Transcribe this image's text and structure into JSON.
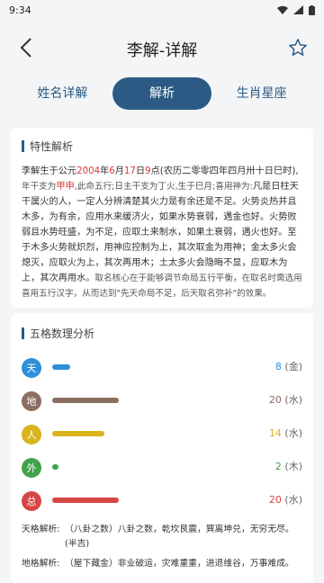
{
  "status_bar": {
    "time": "9:34"
  },
  "header": {
    "title": "李解-详解"
  },
  "tabs": [
    {
      "label": "姓名详解",
      "active": false
    },
    {
      "label": "解析",
      "active": true
    },
    {
      "label": "生肖星座",
      "active": false
    }
  ],
  "characteristic": {
    "section_title": "特性解析",
    "p1_a": "李解生于公元",
    "p1_year": "2004",
    "p1_b": "年",
    "p1_month": "6",
    "p1_c": "月",
    "p1_day": "17",
    "p1_d": "日",
    "p1_hour": "9",
    "p1_e": "点(农历二零零四年四月卅十日巳时),",
    "p2_a": "年干支为",
    "p2_red": "甲申",
    "p2_b": ",此命五行;日主干支为丁火,生于巳月;喜用神为:",
    "p2_c": "凡是日柱天干属火的人，一定人分辨清楚其火力是有余还是不足。火势炎热并且木多，为有余，应用水来缓济火，如果水势衰弱，遇金也好。火势败弱且水势旺盛，为不足，应取土来制水，如果土衰弱，遇火也好。至于木多火势就炽烈，用神应控制为上，其次取金为用神；金太多火会熄灭，应取火为上，其次再用木；土太多火会隐晦不显，应取木为上，其次再用水。",
    "p2_d": "取名核心在于能够调节命局五行平衡，在取名时需选用喜用五行汉字，从而达到\"先天命局不足，后天取名弥补\"的效果。"
  },
  "wuge": {
    "section_title": "五格数理分析",
    "rows": [
      {
        "label": "天",
        "value": "8",
        "element": "(金)",
        "color": "#2f8fd8",
        "fraction": 0.09
      },
      {
        "label": "地",
        "value": "20",
        "element": "(水)",
        "color": "#8b6f62",
        "fraction": 0.33
      },
      {
        "label": "人",
        "value": "14",
        "element": "(水)",
        "color": "#d9b41c",
        "fraction": 0.26
      },
      {
        "label": "外",
        "value": "2",
        "element": "(木)",
        "color": "#43a34a",
        "fraction": 0.03
      },
      {
        "label": "总",
        "value": "20",
        "element": "(水)",
        "color": "#d84545",
        "fraction": 0.33
      }
    ],
    "tiange_label": "天格解析:",
    "tiange_text": "（八卦之数）八卦之数，乾坎艮震，巽离坤兑，无穷无尽。(半吉)",
    "dige_label": "地格解析:",
    "dige_text": "（屋下藏金）非业破运，灾难重重，进退维谷，万事难成。"
  }
}
